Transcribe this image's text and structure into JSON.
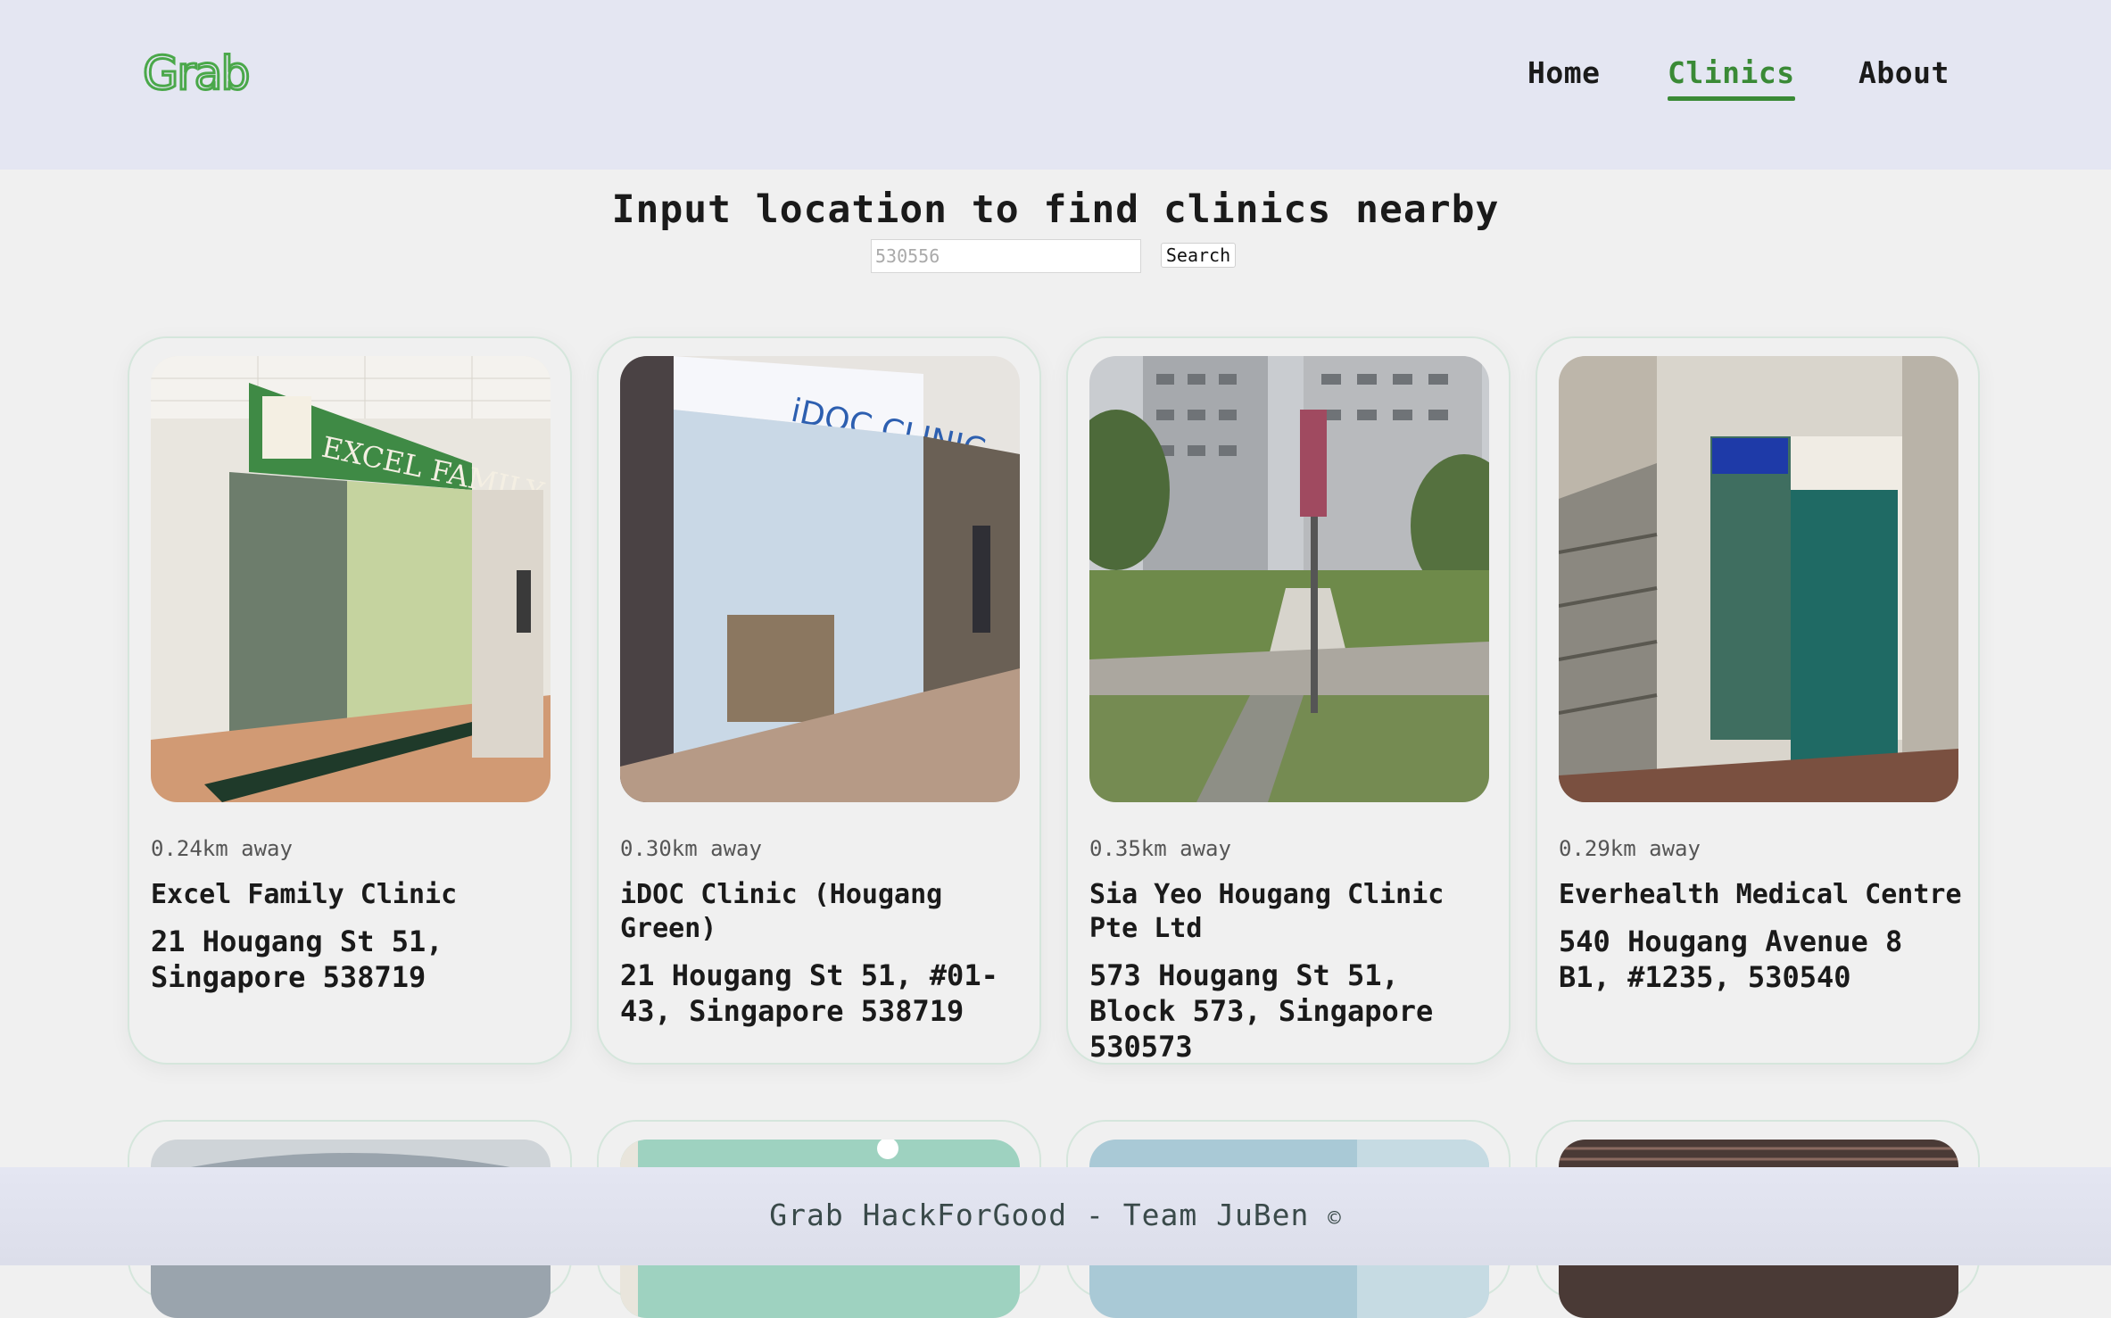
{
  "header": {
    "logo_text": "Grab",
    "nav": [
      {
        "label": "Home"
      },
      {
        "label": "Clinics"
      },
      {
        "label": "About"
      }
    ]
  },
  "main": {
    "title": "Input location to find clinics nearby",
    "search": {
      "value": "",
      "placeholder": "530556",
      "button_label": "Search"
    },
    "clinics": [
      {
        "distance": "0.24km away",
        "name": "Excel Family Clinic",
        "address": "21 Hougang St 51, Singapore 538719"
      },
      {
        "distance": "0.30km away",
        "name": "iDOC Clinic (Hougang Green)",
        "address": "21 Hougang St 51, #01-43, Singapore 538719"
      },
      {
        "distance": "0.35km away",
        "name": "Sia Yeo Hougang Clinic Pte Ltd",
        "address": "573 Hougang St 51, Block 573, Singapore 530573"
      },
      {
        "distance": "0.29km away",
        "name": "Everhealth Medical Centre",
        "address": "540 Hougang Avenue 8 B1, #1235, 530540"
      }
    ]
  },
  "footer": {
    "text": "Grab HackForGood - Team JuBen",
    "copyright": "©"
  },
  "colors": {
    "brand_green": "#3a8a36",
    "header_bg": "#e4e6f2",
    "page_bg": "#f0f0f0"
  }
}
